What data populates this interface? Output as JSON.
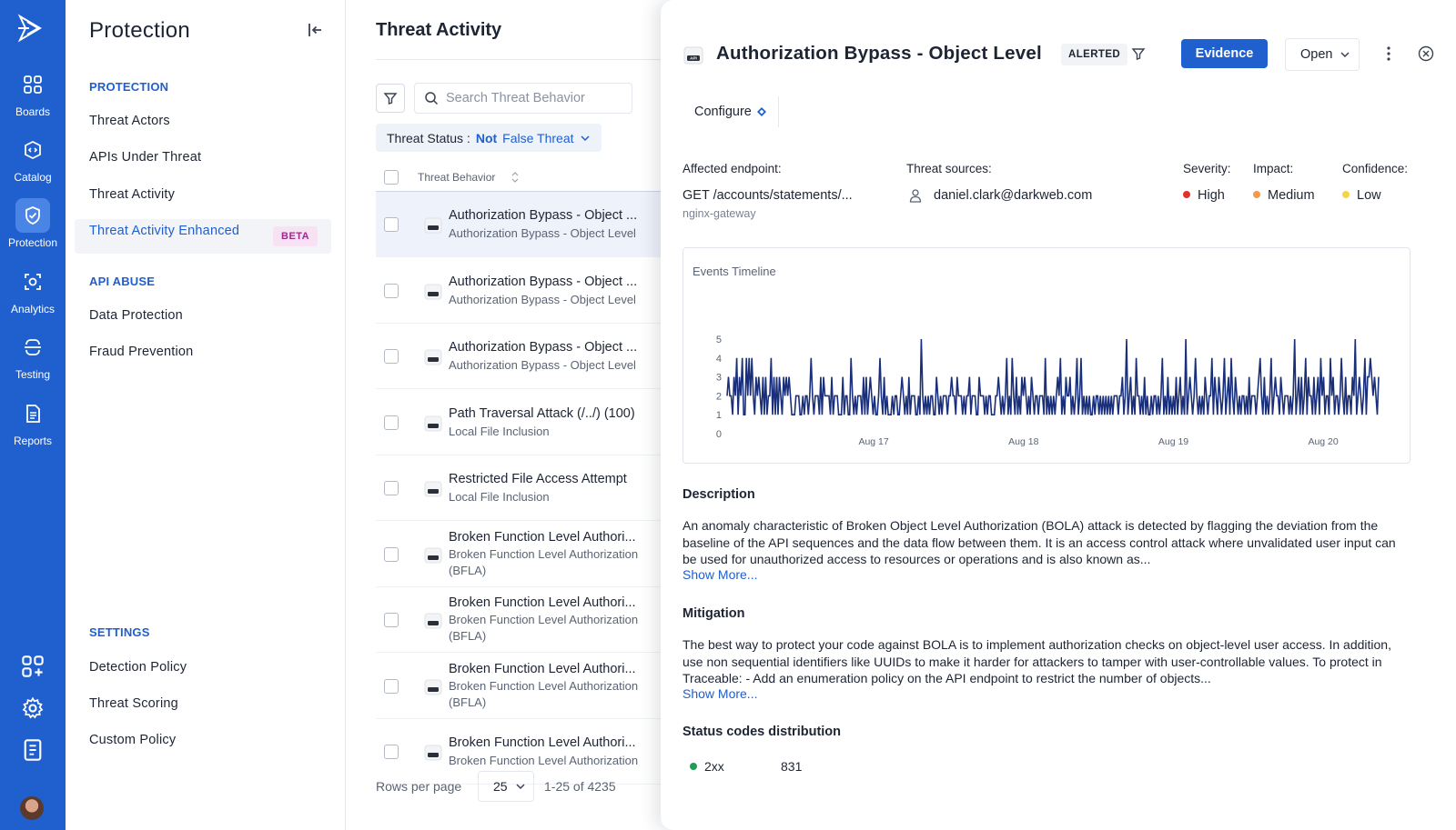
{
  "rail": {
    "items": [
      {
        "label": "Boards",
        "icon": "boards-icon"
      },
      {
        "label": "Catalog",
        "icon": "catalog-icon"
      },
      {
        "label": "Protection",
        "icon": "shield-icon",
        "active": true
      },
      {
        "label": "Analytics",
        "icon": "analytics-icon"
      },
      {
        "label": "Testing",
        "icon": "testing-icon"
      },
      {
        "label": "Reports",
        "icon": "reports-icon"
      }
    ],
    "colors": {
      "background": "#1f5fce",
      "active": "#4a85e6"
    }
  },
  "nav": {
    "title": "Protection",
    "sections": {
      "protection": "PROTECTION",
      "api_abuse": "API ABUSE",
      "settings": "SETTINGS"
    },
    "protection_items": [
      "Threat Actors",
      "APIs Under Threat",
      "Threat Activity",
      "Threat Activity Enhanced"
    ],
    "beta_label": "BETA",
    "api_abuse_items": [
      "Data Protection",
      "Fraud Prevention"
    ],
    "settings_items": [
      "Detection Policy",
      "Threat Scoring",
      "Custom Policy"
    ]
  },
  "list": {
    "title": "Threat Activity",
    "search_placeholder": "Search Threat Behavior",
    "status_filter": {
      "key": "Threat Status :",
      "negation": "Not",
      "value": "False Threat"
    },
    "column_header": "Threat Behavior",
    "rows": [
      {
        "title": "Authorization Bypass - Object ...",
        "subtitle": "Authorization Bypass - Object Level",
        "selected": true
      },
      {
        "title": "Authorization Bypass - Object ...",
        "subtitle": "Authorization Bypass - Object Level"
      },
      {
        "title": "Authorization Bypass - Object ...",
        "subtitle": "Authorization Bypass - Object Level"
      },
      {
        "title": "Path Traversal Attack (/../) (100)",
        "subtitle": "Local File Inclusion"
      },
      {
        "title": "Restricted File Access Attempt",
        "subtitle": "Local File Inclusion"
      },
      {
        "title": "Broken Function Level Authori...",
        "subtitle": "Broken Function Level Authorization",
        "subtitle2": "(BFLA)"
      },
      {
        "title": "Broken Function Level Authori...",
        "subtitle": "Broken Function Level Authorization",
        "subtitle2": "(BFLA)"
      },
      {
        "title": "Broken Function Level Authori...",
        "subtitle": "Broken Function Level Authorization",
        "subtitle2": "(BFLA)"
      },
      {
        "title": "Broken Function Level Authori...",
        "subtitle": "Broken Function Level Authorization"
      }
    ],
    "pagination": {
      "rows_per_page_label": "Rows per page",
      "rows_per_page": "25",
      "range": "1-25 of 4235"
    }
  },
  "detail": {
    "title": "Authorization Bypass - Object Level",
    "status_badge": "ALERTED",
    "evidence_label": "Evidence",
    "state_select": "Open",
    "configure_label": "Configure",
    "affected_endpoint": {
      "label": "Affected endpoint:",
      "value": "GET /accounts/statements/...",
      "gateway": "nginx-gateway"
    },
    "threat_sources": {
      "label": "Threat sources:",
      "value": "daniel.clark@darkweb.com"
    },
    "severity": {
      "label": "Severity:",
      "value": "High",
      "color": "#e0312b"
    },
    "impact": {
      "label": "Impact:",
      "value": "Medium",
      "color": "#f2994a"
    },
    "confidence": {
      "label": "Confidence:",
      "value": "Low",
      "color": "#f6d44a"
    },
    "description": {
      "heading": "Description",
      "text": "An anomaly characteristic of Broken Object Level Authorization (BOLA) attack is detected by flagging the deviation from the baseline of the API sequences and the data flow between them. It is an access control attack where unvalidated user input can be used for unauthorized access to resources or operations and is also known as...",
      "more": "Show More..."
    },
    "mitigation": {
      "heading": "Mitigation",
      "text": "The best way to protect your code against BOLA is to implement authorization checks on object-level user access. In addition, use non sequential identifiers like UUIDs to make it harder for attackers to tamper with user-controllable values. To protect in Traceable: - Add an enumeration policy on the API endpoint to restrict the number of objects...",
      "more": "Show More..."
    },
    "status_codes": {
      "heading": "Status codes distribution",
      "rows": [
        {
          "code": "2xx",
          "count": "831",
          "color": "#1f9d55"
        }
      ]
    }
  },
  "chart_data": {
    "type": "line",
    "title": "Events Timeline",
    "xlabel": "",
    "ylabel": "",
    "x_ticks": [
      "Aug 17",
      "Aug 18",
      "Aug 19",
      "Aug 20"
    ],
    "yticks": [
      0,
      1,
      2,
      3,
      4,
      5
    ],
    "ylim": [
      0,
      5
    ],
    "grid": false,
    "series": [
      {
        "color": "#1a2f7a",
        "values": [
          2,
          3,
          2,
          2,
          1,
          3,
          2,
          4,
          1,
          3,
          2,
          4,
          1,
          1,
          4,
          2,
          4,
          2,
          4,
          2,
          1,
          3,
          2,
          3,
          2,
          1,
          3,
          1,
          3,
          1,
          2,
          2,
          4,
          1,
          3,
          1,
          3,
          1,
          3,
          2,
          1,
          3,
          2,
          3,
          2,
          3,
          2,
          1,
          1,
          1,
          2,
          2,
          2,
          1,
          1,
          2,
          1,
          2,
          2,
          1,
          2,
          4,
          2,
          1,
          2,
          2,
          2,
          1,
          3,
          1,
          3,
          2,
          2,
          2,
          2,
          1,
          3,
          1,
          2,
          2,
          2,
          1,
          1,
          1,
          3,
          1,
          2,
          2,
          1,
          1,
          4,
          2,
          1,
          2,
          1,
          2,
          2,
          2,
          1,
          3,
          1,
          3,
          1,
          2,
          3,
          2,
          1,
          2,
          1,
          1,
          2,
          4,
          2,
          1,
          3,
          1,
          2,
          1,
          1,
          1,
          2,
          1,
          2,
          2,
          1,
          1,
          2,
          3,
          2,
          1,
          2,
          1,
          3,
          1,
          2,
          2,
          2,
          1,
          1,
          2,
          1,
          5,
          2,
          1,
          2,
          1,
          2,
          1,
          2,
          2,
          1,
          1,
          3,
          2,
          1,
          2,
          1,
          2,
          2,
          2,
          1,
          2,
          2,
          3,
          2,
          2,
          1,
          3,
          2,
          2,
          2,
          1,
          2,
          1,
          2,
          2,
          3,
          1,
          2,
          2,
          2,
          1,
          1,
          3,
          2,
          2,
          2,
          1,
          2,
          1,
          2,
          2,
          1,
          1,
          1,
          2,
          2,
          3,
          2,
          1,
          2,
          1,
          2,
          4,
          1,
          2,
          1,
          4,
          2,
          1,
          3,
          1,
          2,
          1,
          3,
          2,
          3,
          2,
          1,
          2,
          1,
          3,
          2,
          1,
          2,
          2,
          1,
          2,
          2,
          2,
          1,
          4,
          1,
          2,
          1,
          2,
          1,
          2,
          1,
          2,
          3,
          2,
          4,
          1,
          2,
          1,
          3,
          2,
          2,
          3,
          1,
          2,
          1,
          2,
          4,
          1,
          2,
          4,
          1,
          2,
          1,
          2,
          1,
          2,
          1,
          1,
          2,
          1,
          2,
          2,
          1,
          2,
          1,
          2,
          1,
          2,
          1,
          2,
          1,
          2,
          1,
          2,
          2,
          2,
          1,
          2,
          2,
          3,
          1,
          2,
          5,
          1,
          2,
          3,
          1,
          2,
          1,
          4,
          2,
          2,
          1,
          2,
          1,
          3,
          1,
          2,
          1,
          1,
          2,
          1,
          2,
          2,
          1,
          2,
          1,
          2,
          4,
          1,
          2,
          1,
          3,
          1,
          2,
          1,
          2,
          1,
          3,
          1,
          2,
          3,
          1,
          2,
          1,
          5,
          1,
          2,
          3,
          2,
          1,
          2,
          4,
          2,
          1,
          2,
          1,
          2,
          1,
          3,
          2,
          1,
          2,
          2,
          4,
          1,
          3,
          2,
          1,
          3,
          2,
          1,
          2,
          4,
          1,
          2,
          3,
          1,
          4,
          2,
          1,
          3,
          2,
          1,
          2,
          1,
          2,
          2,
          1,
          2,
          1,
          3,
          1,
          2,
          2,
          2,
          1,
          2,
          3,
          4,
          2,
          1,
          3,
          1,
          2,
          1,
          2,
          4,
          1,
          2,
          3,
          2,
          2,
          1,
          3,
          2,
          1,
          2,
          2,
          2,
          1,
          2,
          1,
          2,
          5,
          1,
          2,
          3,
          1,
          3,
          1,
          2,
          4,
          1,
          3,
          2,
          2,
          1,
          3,
          1,
          2,
          3,
          1,
          4,
          2,
          3,
          1,
          2,
          2,
          1,
          4,
          2,
          3,
          1,
          2,
          2,
          1,
          2,
          4,
          2,
          1,
          3,
          1,
          2,
          2,
          1,
          3,
          2,
          5,
          1,
          2,
          3,
          2,
          1,
          2,
          4,
          1,
          3,
          3,
          4,
          3,
          2,
          3,
          2,
          1,
          3
        ]
      }
    ]
  }
}
